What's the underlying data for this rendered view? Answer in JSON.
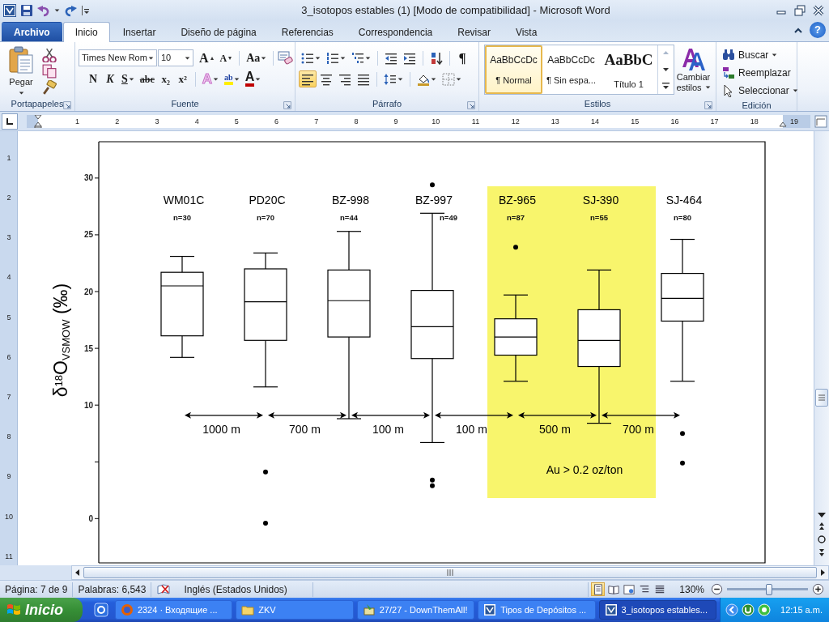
{
  "window": {
    "title": "3_isotopos estables (1) [Modo de compatibilidad] - Microsoft Word",
    "help": "?"
  },
  "tabs": [
    {
      "label": "Archivo",
      "kind": "file",
      "selected": false
    },
    {
      "label": "Inicio",
      "kind": "tab",
      "selected": true
    },
    {
      "label": "Insertar",
      "kind": "tab",
      "selected": false
    },
    {
      "label": "Diseño de página",
      "kind": "tab",
      "selected": false
    },
    {
      "label": "Referencias",
      "kind": "tab",
      "selected": false
    },
    {
      "label": "Correspondencia",
      "kind": "tab",
      "selected": false
    },
    {
      "label": "Revisar",
      "kind": "tab",
      "selected": false
    },
    {
      "label": "Vista",
      "kind": "tab",
      "selected": false
    }
  ],
  "ribbon": {
    "clipboard": {
      "paste_label": "Pegar",
      "group_label": "Portapapeles"
    },
    "font": {
      "font_name": "Times New Rom",
      "font_size": "10",
      "group_label": "Fuente",
      "row1": [
        {
          "kind": "grow",
          "glyph": "A"
        },
        {
          "kind": "shrink",
          "glyph": "A"
        },
        {
          "kind": "case",
          "glyph": "Aa"
        }
      ],
      "row2": [
        {
          "kind": "bold",
          "glyph": "N"
        },
        {
          "kind": "italic",
          "glyph": "K"
        },
        {
          "kind": "underline",
          "glyph": "S"
        },
        {
          "kind": "strike",
          "glyph": "abc"
        },
        {
          "kind": "sub",
          "glyph": "x₂"
        },
        {
          "kind": "sup",
          "glyph": "x²"
        },
        {
          "kind": "effects",
          "glyph": "A"
        },
        {
          "kind": "highlight",
          "glyph": "ab"
        },
        {
          "kind": "color",
          "glyph": "A"
        }
      ]
    },
    "paragraph": {
      "pilcrow": "¶",
      "group_label": "Párrafo",
      "alignments": [
        {
          "kind": "left",
          "selected": true
        },
        {
          "kind": "center",
          "selected": false
        },
        {
          "kind": "right",
          "selected": false
        },
        {
          "kind": "justify",
          "selected": false
        }
      ]
    },
    "styles": {
      "group_label": "Estilos",
      "change_styles": [
        "Cambiar",
        "estilos"
      ],
      "items": [
        {
          "preview": "AaBbCcDc",
          "name": "¶ Normal",
          "kind": "body",
          "selected": true
        },
        {
          "preview": "AaBbCcDc",
          "name": "¶ Sin espa...",
          "kind": "body",
          "selected": false
        },
        {
          "preview": "AaBbC",
          "name": "Título 1",
          "kind": "heading",
          "selected": false
        }
      ]
    },
    "editing": {
      "group_label": "Edición",
      "items": [
        {
          "label": "Buscar",
          "kind": "find"
        },
        {
          "label": "Reemplazar",
          "kind": "replace"
        },
        {
          "label": "Seleccionar",
          "kind": "select"
        }
      ]
    }
  },
  "ruler": {
    "marks": [
      "1",
      "2",
      "3",
      "4",
      "5",
      "6",
      "7",
      "8",
      "9",
      "10",
      "11",
      "12",
      "13",
      "14",
      "15",
      "16",
      "17",
      "18",
      "19"
    ],
    "vertical_marks": [
      "1",
      "2",
      "3",
      "4",
      "5",
      "6",
      "7",
      "8",
      "9",
      "10",
      "11"
    ]
  },
  "chart": {
    "sample_sizes": [
      "n=30",
      "n=70",
      "n=44",
      "n=49",
      "n=87",
      "n=55",
      "n=80"
    ],
    "distances": [
      "1000 m",
      "700 m",
      "100 m",
      "100 m",
      "500 m",
      "700 m"
    ],
    "highlight": {
      "label": "Au > 0.2 oz/ton"
    },
    "chart_data": {
      "type": "box",
      "ylabel": "δ$^{18}$O$_{VSMOW}$ (‰)",
      "ylim": [
        -3.9,
        33.2
      ],
      "yticks": [
        0,
        10,
        15,
        20,
        25,
        30
      ],
      "categories": [
        "WM01C",
        "PD20C",
        "BZ-998",
        "BZ-997",
        "BZ-965",
        "SJ-390",
        "SJ-464"
      ],
      "boxes": [
        {
          "low": 14.2,
          "q1": 16.1,
          "median": 20.5,
          "q3": 21.7,
          "high": 23.1
        },
        {
          "low": 11.6,
          "q1": 15.7,
          "median": 19.1,
          "q3": 22.0,
          "high": 23.4,
          "outliers": [
            4.1,
            -0.4
          ]
        },
        {
          "low": 8.8,
          "q1": 16.0,
          "median": 19.2,
          "q3": 21.9,
          "high": 25.3
        },
        {
          "low": 6.7,
          "q1": 14.1,
          "median": 16.9,
          "q3": 20.1,
          "high": 26.9,
          "outliers": [
            29.4,
            3.4,
            2.9
          ]
        },
        {
          "low": 12.1,
          "q1": 14.4,
          "median": 16.0,
          "q3": 17.6,
          "high": 19.7,
          "outliers": [
            23.9
          ]
        },
        {
          "low": 8.4,
          "q1": 13.4,
          "median": 15.7,
          "q3": 18.4,
          "high": 21.9
        },
        {
          "low": 12.1,
          "q1": 17.4,
          "median": 19.4,
          "q3": 21.6,
          "high": 24.6,
          "outliers": [
            7.5,
            4.9
          ]
        }
      ]
    }
  },
  "status_bar": {
    "page": "Página: 7 de 9",
    "words": "Palabras: 6,543",
    "language": "Inglés (Estados Unidos)",
    "views": [
      {
        "kind": "print",
        "selected": true
      },
      {
        "kind": "reading",
        "selected": false
      },
      {
        "kind": "web",
        "selected": false
      },
      {
        "kind": "outline",
        "selected": false
      },
      {
        "kind": "draft",
        "selected": false
      }
    ],
    "zoom": "130%",
    "zoom_slider": {
      "level": 0.52
    }
  },
  "taskbar": {
    "start": "Inicio",
    "tasks": [
      {
        "label": "2324 · Входящие ...",
        "kind": "browser",
        "selected": false
      },
      {
        "label": "ZKV",
        "kind": "folder",
        "selected": false
      },
      {
        "label": "27/27 - DownThemAll!",
        "kind": "download",
        "selected": false
      },
      {
        "label": "Tipos de Depósitos ...",
        "kind": "word",
        "selected": false
      },
      {
        "label": "3_isotopos estables...",
        "kind": "word",
        "selected": true
      }
    ],
    "clock": "12:15 a.m."
  }
}
